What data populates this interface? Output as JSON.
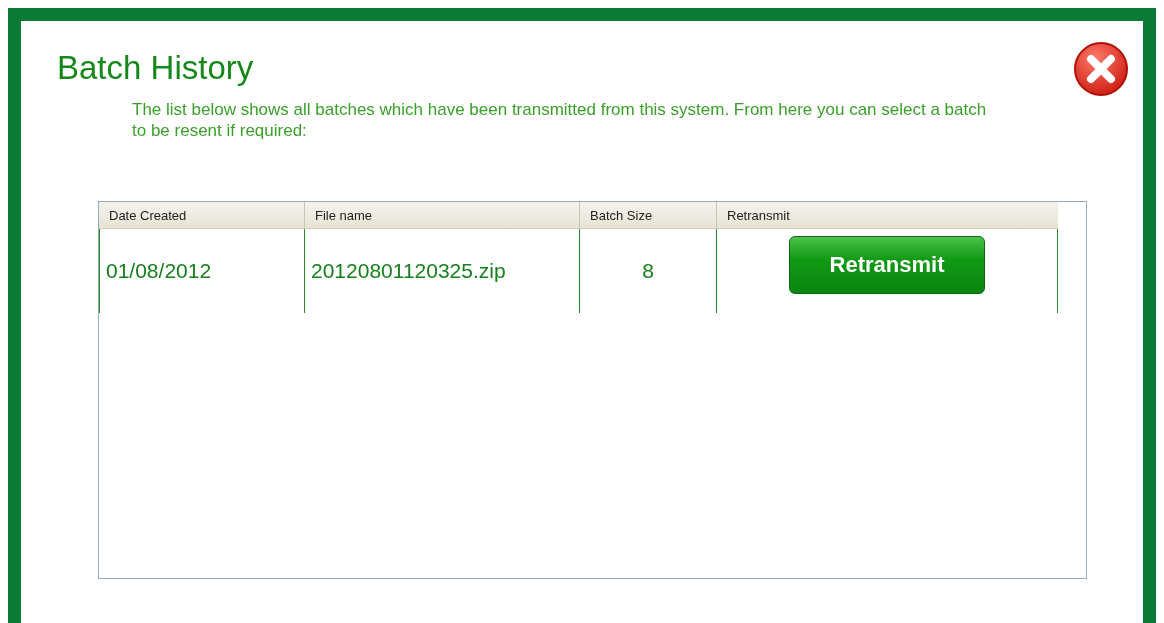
{
  "title": "Batch History",
  "description": "The list below shows all batches which have been transmitted from this system. From here you can select a batch to be resent if required:",
  "table": {
    "columns": [
      "Date Created",
      "File name",
      "Batch Size",
      "Retransmit"
    ],
    "rows": [
      {
        "date": "01/08/2012",
        "file": "20120801120325.zip",
        "size": "8",
        "action": "Retransmit"
      }
    ]
  }
}
